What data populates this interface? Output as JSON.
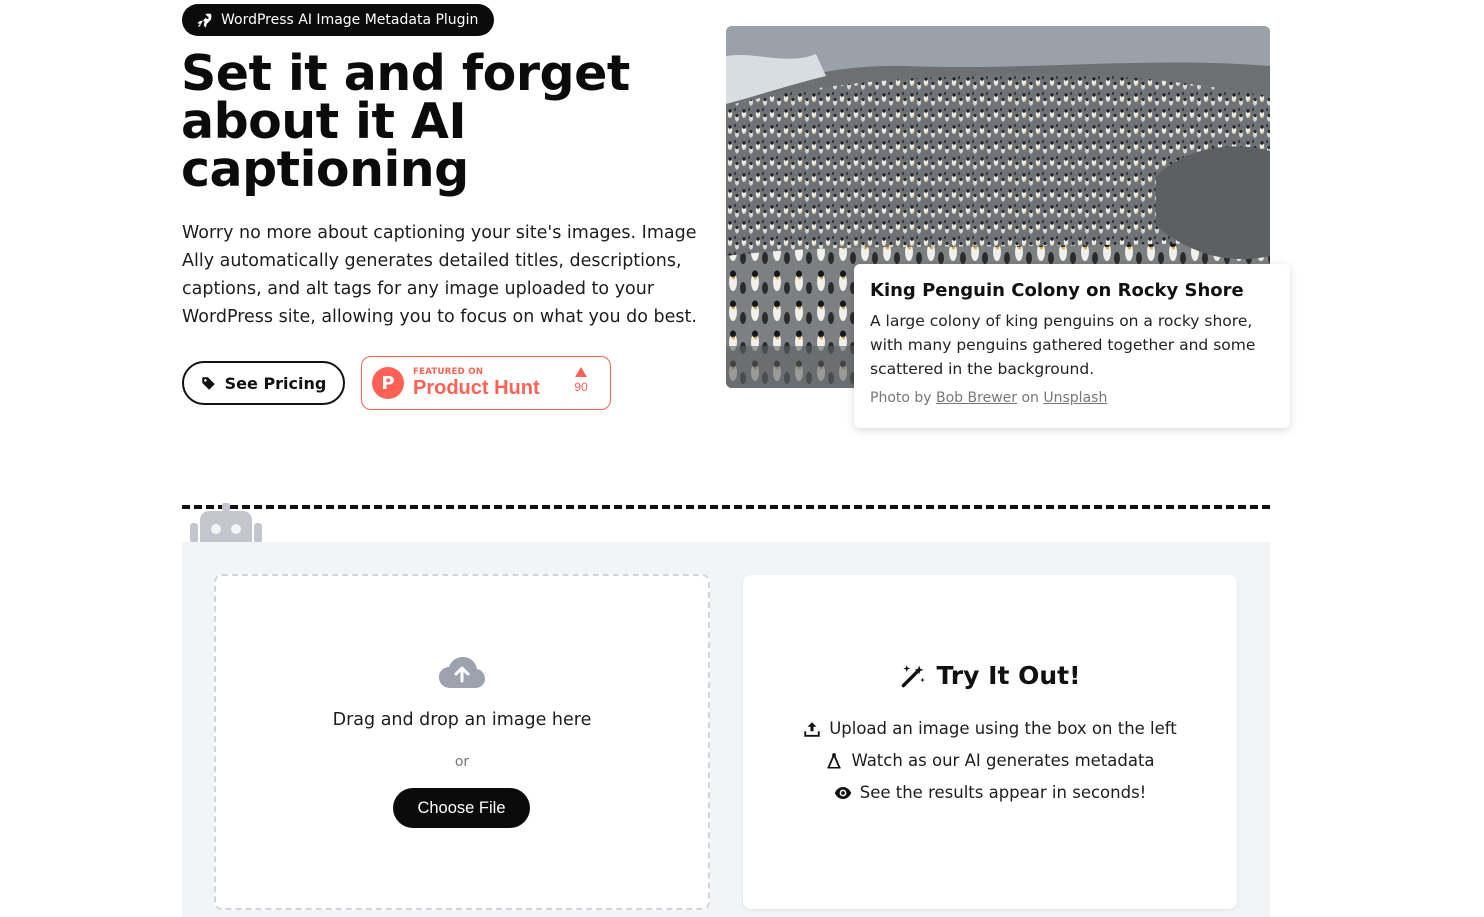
{
  "hero": {
    "badge_label": "WordPress AI Image Metadata Plugin",
    "badge_icon": "rocket-icon",
    "headline": "Set it and forget about it AI captioning",
    "lead": "Worry no more about captioning your site's images. Image Ally automatically generates detailed titles, descriptions, captions, and alt tags for any image uploaded to your WordPress site, allowing you to focus on what you do best.",
    "pricing_label": "See Pricing",
    "pricing_icon": "tag-icon",
    "product_hunt": {
      "featured_label": "FEATURED ON",
      "name": "Product Hunt",
      "logo_letter": "P",
      "votes": "90",
      "color": "#ff6154"
    }
  },
  "example": {
    "image_icon": "penguin-colony-photo",
    "title": "King Penguin Colony on Rocky Shore",
    "description": "A large colony of king penguins on a rocky shore, with many penguins gathered together and some scattered in the background.",
    "credit_prefix": "Photo by",
    "photographer": "Bob Brewer",
    "credit_middle": "on",
    "source": "Unsplash"
  },
  "uploader": {
    "cloud_icon": "cloud-upload-icon",
    "drag_text": "Drag and drop an image here",
    "or_text": "or",
    "choose_label": "Choose File"
  },
  "try_it": {
    "title": "Try It Out!",
    "title_icon": "magic-wand-icon",
    "steps": [
      {
        "icon": "upload-icon",
        "text": "Upload an image using the box on the left"
      },
      {
        "icon": "compass-drafting-icon",
        "text": "Watch as our AI generates metadata"
      },
      {
        "icon": "eye-icon",
        "text": "See the results appear in seconds!"
      }
    ]
  },
  "colors": {
    "dark": "#0b0b0b",
    "panel_bg": "#f3f4f6",
    "accent": "#ff6154"
  }
}
